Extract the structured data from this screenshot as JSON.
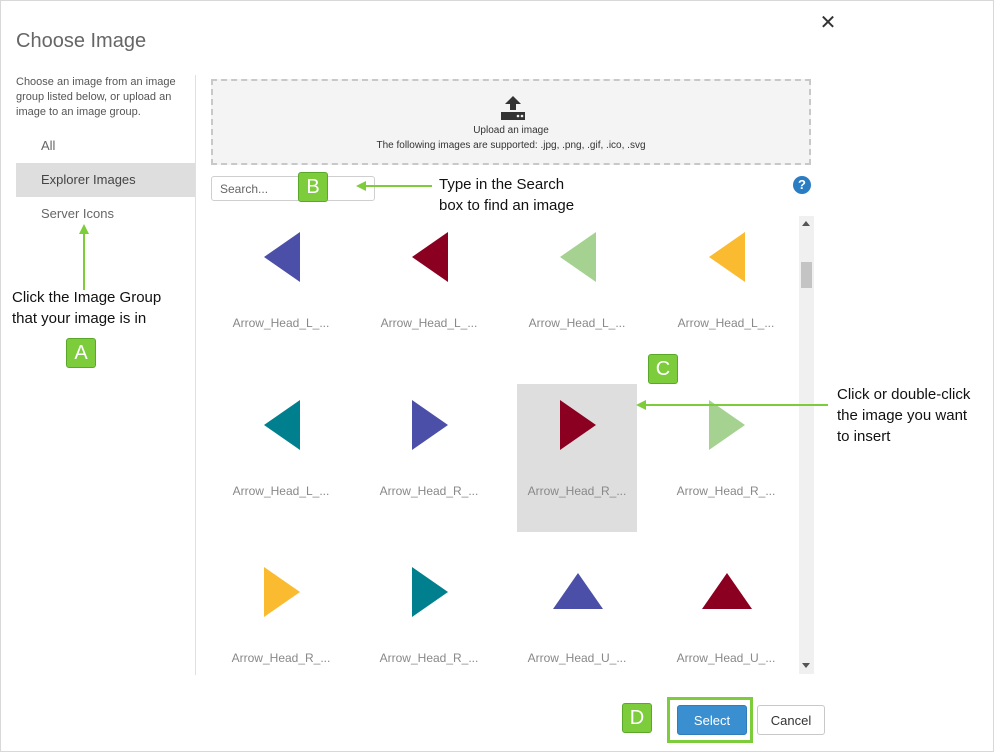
{
  "dialog": {
    "title": "Choose Image",
    "close_symbol": "✕"
  },
  "sidebar": {
    "description": "Choose an image from an image group listed below, or upload an image to an image group.",
    "groups": [
      "All",
      "Explorer Images",
      "Server Icons"
    ]
  },
  "upload": {
    "icon": "upload-icon",
    "title": "Upload an image",
    "supported": "The following images are supported: .jpg, .png, .gif, .ico, .svg"
  },
  "search": {
    "placeholder": "Search..."
  },
  "help": {
    "symbol": "?"
  },
  "images": [
    {
      "label": "Arrow_Head_L_...",
      "color": "#4b4fa8",
      "dir": "left"
    },
    {
      "label": "Arrow_Head_L_...",
      "color": "#8b0020",
      "dir": "left"
    },
    {
      "label": "Arrow_Head_L_...",
      "color": "#a5d290",
      "dir": "left"
    },
    {
      "label": "Arrow_Head_L_...",
      "color": "#fbbb31",
      "dir": "left"
    },
    {
      "label": "Arrow_Head_L_...",
      "color": "#00808e",
      "dir": "left"
    },
    {
      "label": "Arrow_Head_R_...",
      "color": "#4b4fa8",
      "dir": "right"
    },
    {
      "label": "Arrow_Head_R_...",
      "color": "#8b0020",
      "dir": "right",
      "selected": true
    },
    {
      "label": "Arrow_Head_R_...",
      "color": "#a5d290",
      "dir": "right"
    },
    {
      "label": "Arrow_Head_R_...",
      "color": "#fbbb31",
      "dir": "right"
    },
    {
      "label": "Arrow_Head_R_...",
      "color": "#00808e",
      "dir": "right"
    },
    {
      "label": "Arrow_Head_U_...",
      "color": "#4b4fa8",
      "dir": "up"
    },
    {
      "label": "Arrow_Head_U_...",
      "color": "#8b0020",
      "dir": "up"
    }
  ],
  "buttons": {
    "select": "Select",
    "cancel": "Cancel"
  },
  "annotations": {
    "accent": "#7dcc3c",
    "a": {
      "badge": "A",
      "text": [
        "Click the Image Group",
        "that your image is in"
      ]
    },
    "b": {
      "badge": "B",
      "text": [
        "Type in the Search",
        "box to find an image"
      ]
    },
    "c": {
      "badge": "C",
      "text": [
        "Click or double-click",
        "the image you want",
        "to insert"
      ]
    },
    "d": {
      "badge": "D"
    }
  }
}
